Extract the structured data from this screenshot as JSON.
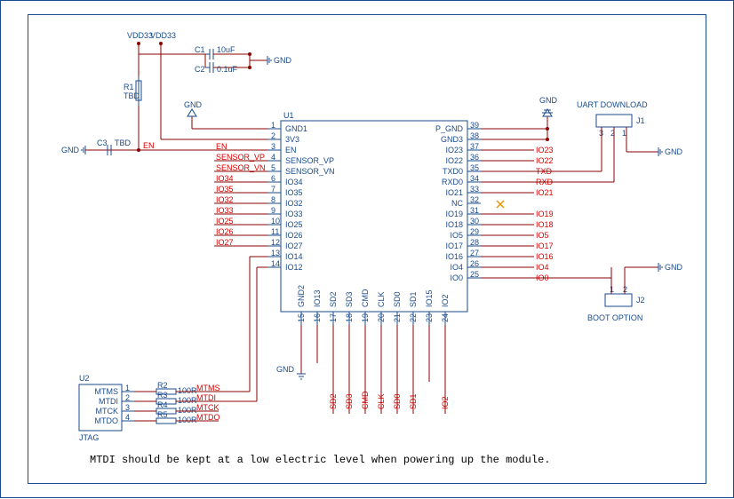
{
  "power": {
    "vdd": "VDD33",
    "gnd": "GND"
  },
  "caps": {
    "c1": {
      "ref": "C1",
      "val": "10uF"
    },
    "c2": {
      "ref": "C2",
      "val": "0.1uF"
    },
    "c3": {
      "ref": "C3",
      "val": "TBD"
    }
  },
  "r1": {
    "ref": "R1",
    "val": "TBD"
  },
  "nets": {
    "en": "EN",
    "svp": "SENSOR_VP",
    "svn": "SENSOR_VN"
  },
  "u1": {
    "ref": "U1",
    "left": [
      {
        "n": "1",
        "name": "GND1",
        "net": ""
      },
      {
        "n": "2",
        "name": "3V3",
        "net": ""
      },
      {
        "n": "3",
        "name": "EN",
        "net": "EN"
      },
      {
        "n": "4",
        "name": "SENSOR_VP",
        "net": "SENSOR_VP"
      },
      {
        "n": "5",
        "name": "SENSOR_VN",
        "net": "SENSOR_VN"
      },
      {
        "n": "6",
        "name": "IO34",
        "net": "IO34"
      },
      {
        "n": "7",
        "name": "IO35",
        "net": "IO35"
      },
      {
        "n": "8",
        "name": "IO32",
        "net": "IO32"
      },
      {
        "n": "9",
        "name": "IO33",
        "net": "IO33"
      },
      {
        "n": "10",
        "name": "IO25",
        "net": "IO25"
      },
      {
        "n": "11",
        "name": "IO26",
        "net": "IO26"
      },
      {
        "n": "12",
        "name": "IO27",
        "net": "IO27"
      },
      {
        "n": "13",
        "name": "IO14",
        "net": ""
      },
      {
        "n": "14",
        "name": "IO12",
        "net": ""
      }
    ],
    "right": [
      {
        "n": "39",
        "name": "P_GND",
        "net": ""
      },
      {
        "n": "38",
        "name": "GND3",
        "net": ""
      },
      {
        "n": "37",
        "name": "IO23",
        "net": "IO23"
      },
      {
        "n": "36",
        "name": "IO22",
        "net": "IO22"
      },
      {
        "n": "35",
        "name": "TXD0",
        "net": "TXD"
      },
      {
        "n": "34",
        "name": "RXD0",
        "net": "RXD"
      },
      {
        "n": "33",
        "name": "IO21",
        "net": "IO21"
      },
      {
        "n": "32",
        "name": "NC",
        "net": ""
      },
      {
        "n": "31",
        "name": "IO19",
        "net": "IO19"
      },
      {
        "n": "30",
        "name": "IO18",
        "net": "IO18"
      },
      {
        "n": "29",
        "name": "IO5",
        "net": "IO5"
      },
      {
        "n": "28",
        "name": "IO17",
        "net": "IO17"
      },
      {
        "n": "27",
        "name": "IO16",
        "net": "IO16"
      },
      {
        "n": "26",
        "name": "IO4",
        "net": "IO4"
      },
      {
        "n": "25",
        "name": "IO0",
        "net": "IO0"
      }
    ],
    "bottom": [
      {
        "n": "15",
        "name": "GND2"
      },
      {
        "n": "16",
        "name": "IO13"
      },
      {
        "n": "17",
        "name": "SD2"
      },
      {
        "n": "18",
        "name": "SD3"
      },
      {
        "n": "19",
        "name": "CMD"
      },
      {
        "n": "20",
        "name": "CLK"
      },
      {
        "n": "21",
        "name": "SD0"
      },
      {
        "n": "22",
        "name": "SD1"
      },
      {
        "n": "23",
        "name": "IO15"
      },
      {
        "n": "24",
        "name": "IO2"
      }
    ],
    "bottom_nets": [
      "",
      "",
      "SD2",
      "SD3",
      "CMD",
      "CLK",
      "SD0",
      "SD1",
      "",
      "IO2"
    ]
  },
  "u2": {
    "ref": "U2",
    "title": "JTAG",
    "pins": [
      {
        "n": "1",
        "name": "MTMS",
        "net": "MTMS",
        "r": "R2",
        "rv": "100R"
      },
      {
        "n": "2",
        "name": "MTDI",
        "net": "MTDI",
        "r": "R3",
        "rv": "100R"
      },
      {
        "n": "3",
        "name": "MTCK",
        "net": "MTCK",
        "r": "R4",
        "rv": "100R"
      },
      {
        "n": "4",
        "name": "MTDO",
        "net": "MTDO",
        "r": "R5",
        "rv": "100R"
      }
    ]
  },
  "j1": {
    "ref": "J1",
    "title": "UART DOWNLOAD",
    "pins": [
      "3",
      "2",
      "1"
    ]
  },
  "j2": {
    "ref": "J2",
    "title": "BOOT OPTION",
    "pins": [
      "1",
      "2"
    ]
  },
  "note": "MTDI should be kept at a low electric level when powering up the module."
}
